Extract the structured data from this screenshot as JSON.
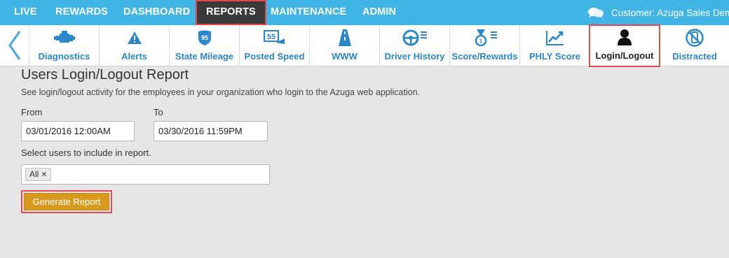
{
  "topnav": {
    "items": [
      "LIVE",
      "REWARDS",
      "DASHBOARD",
      "REPORTS",
      "MAINTENANCE",
      "ADMIN"
    ],
    "active": "REPORTS",
    "customer": "Customer: Azuga Sales Dem"
  },
  "iconbar": {
    "back_icon": "chevron-left-icon",
    "tiles": [
      {
        "label": "Diagnostics",
        "icon": "engine-icon"
      },
      {
        "label": "Alerts",
        "icon": "alert-triangle-icon"
      },
      {
        "label": "State Mileage",
        "icon": "interstate-95-icon"
      },
      {
        "label": "Posted Speed",
        "icon": "speed-limit-55-icon"
      },
      {
        "label": "WWW",
        "icon": "road-icon"
      },
      {
        "label": "Driver History",
        "icon": "steering-wheel-list-icon"
      },
      {
        "label": "Score/Rewards",
        "icon": "medal-list-icon"
      },
      {
        "label": "PHLY Score",
        "icon": "trend-chart-icon"
      },
      {
        "label": "Login/Logout",
        "icon": "user-icon"
      },
      {
        "label": "Distracted",
        "icon": "no-phone-icon"
      }
    ],
    "selected": "Login/Logout"
  },
  "report": {
    "title": "Users Login/Logout Report",
    "description": "See login/logout activity for the employees in your organization who login to the Azuga web application.",
    "from_label": "From",
    "from_value": "03/01/2016 12:00AM",
    "to_label": "To",
    "to_value": "03/30/2016 11:59PM",
    "users_label": "Select users to include in report.",
    "users_tag": "All",
    "users_tag_remove": "×",
    "generate_label": "Generate Report"
  },
  "colors": {
    "nav_bg": "#41b6e6",
    "active_nav_bg": "#3a3a3a",
    "highlight": "#e8474b",
    "tile_text": "#2b87c8",
    "button": "#d79a1f"
  }
}
